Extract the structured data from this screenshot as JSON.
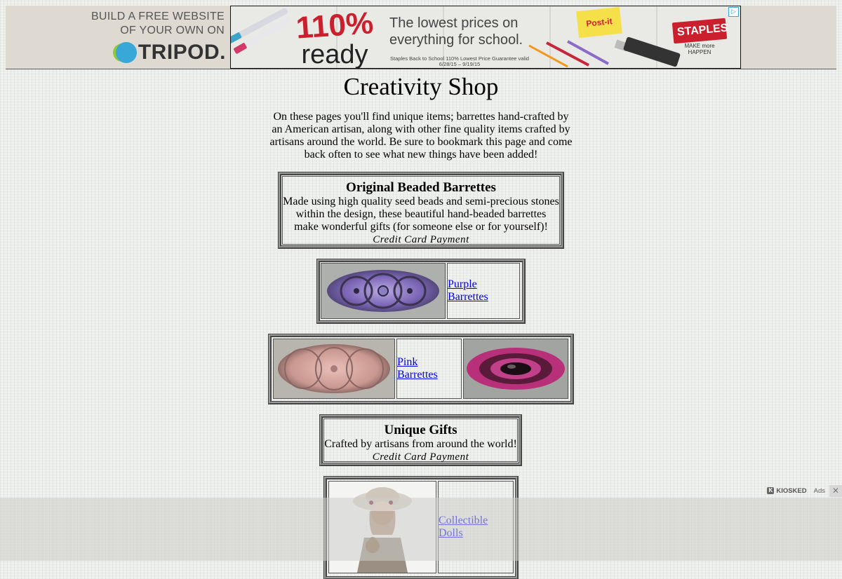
{
  "banner": {
    "tripod_line1": "BUILD A FREE WEBSITE",
    "tripod_line2": "OF YOUR OWN ON",
    "tripod_logo": "TRIPOD.",
    "ad": {
      "percent": "110%",
      "ready": "ready",
      "copy": "The lowest prices on everything for school.",
      "fineprint": "Staples Back to School 110% Lowest Price Guarantee valid 6/28/15 – 9/19/15",
      "postit": "Post-it",
      "brand": "STAPLES",
      "tagline": "MAKE more HAPPEN",
      "ad_choices_icon": "adchoices-icon"
    }
  },
  "page": {
    "title": "Creativity Shop",
    "intro": "On these pages you'll find unique items; barrettes hand-crafted by an American artisan, along with other fine quality items crafted by artisans around the world. Be sure to bookmark this page and come back often to see what new things have been added!"
  },
  "sections": {
    "barrettes": {
      "heading": "Original Beaded Barrettes",
      "body": "Made using high quality seed beads and semi-precious stones within the design, these beautiful hand-beaded barrettes make wonderful gifts (for someone else or for yourself)!",
      "credit": "Credit Card Payment"
    },
    "purple": {
      "link": "Purple Barrettes"
    },
    "pink": {
      "link": "Pink Barrettes"
    },
    "gifts": {
      "heading": "Unique Gifts",
      "body": "Crafted by artisans from around the world!",
      "credit": "Credit Card Payment"
    },
    "dolls": {
      "link": "Collectible Dolls"
    }
  },
  "overlay": {
    "brand": "KIOSKED",
    "ads_label": "Ads",
    "close": "✕"
  },
  "colors": {
    "link": "#0000ee",
    "staples_red": "#cc1f2d",
    "tripod_blue": "#39a7d8"
  }
}
